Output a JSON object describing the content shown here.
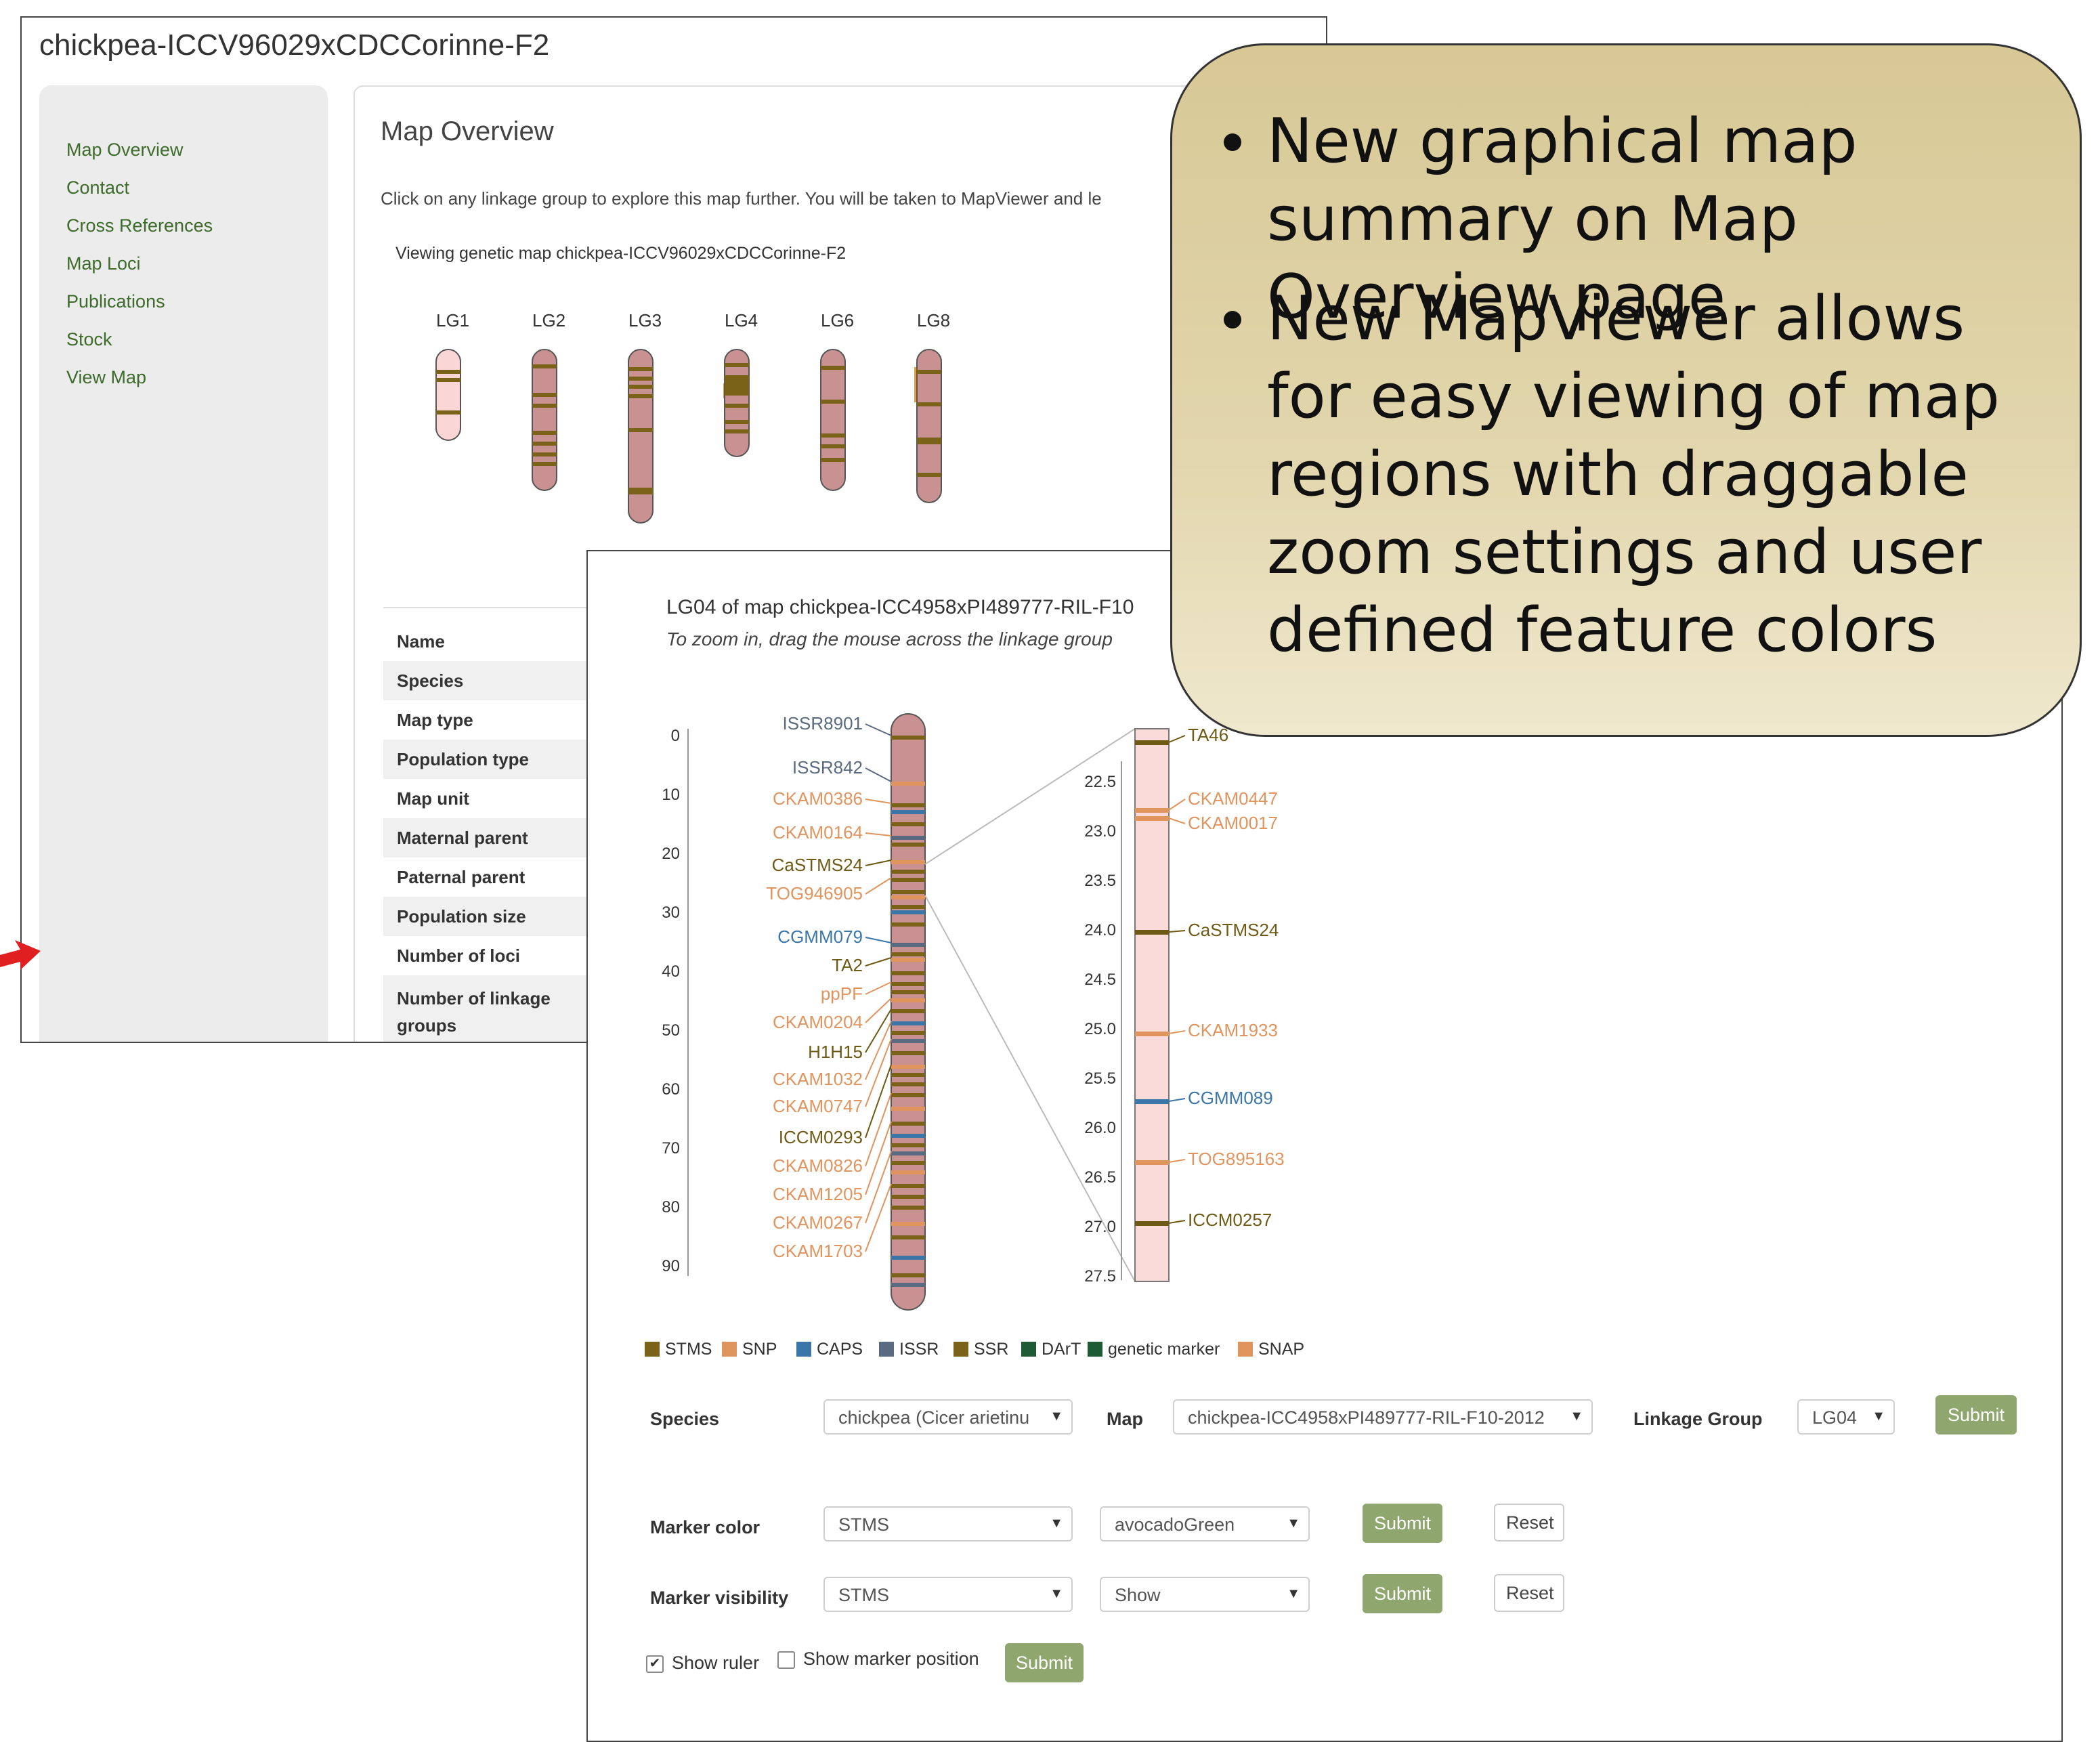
{
  "back_window": {
    "title": "chickpea-ICCV96029xCDCCorinne-F2",
    "sidebar_items": [
      {
        "label": "Map Overview"
      },
      {
        "label": "Contact"
      },
      {
        "label": "Cross References"
      },
      {
        "label": "Map Loci"
      },
      {
        "label": "Publications"
      },
      {
        "label": "Stock"
      },
      {
        "label": "View Map"
      }
    ],
    "heading": "Map Overview",
    "description": "Click on any linkage group to explore this map further. You will be taken to MapViewer and le",
    "viewing_text": "Viewing genetic map chickpea-ICCV96029xCDCCorinne-F2",
    "linkage_groups": [
      "LG1",
      "LG2",
      "LG3",
      "LG4",
      "LG6",
      "LG8"
    ],
    "fields": [
      "Name",
      "Species",
      "Map type",
      "Population type",
      "Map unit",
      "Maternal parent",
      "Paternal parent",
      "Population size",
      "Number of loci",
      "Number of linkage groups"
    ]
  },
  "front_window": {
    "title": "LG04 of map chickpea-ICC4958xPI489777-RIL-F10",
    "subtitle": "To zoom in, drag the mouse across the linkage group",
    "left_axis_ticks": [
      "0",
      "10",
      "20",
      "30",
      "40",
      "50",
      "60",
      "70",
      "80",
      "90"
    ],
    "left_markers": [
      {
        "name": "ISSR8901",
        "color": "#5a6a80"
      },
      {
        "name": "ISSR842",
        "color": "#5a6a80"
      },
      {
        "name": "CKAM0386",
        "color": "#e0945e"
      },
      {
        "name": "CKAM0164",
        "color": "#e0945e"
      },
      {
        "name": "CaSTMS24",
        "color": "#6e5a14"
      },
      {
        "name": "TOG946905",
        "color": "#e0945e"
      },
      {
        "name": "CGMM079",
        "color": "#3a76a8"
      },
      {
        "name": "TA2",
        "color": "#6e5a14"
      },
      {
        "name": "ppPF",
        "color": "#e0945e"
      },
      {
        "name": "CKAM0204",
        "color": "#e0945e"
      },
      {
        "name": "H1H15",
        "color": "#6e5a14"
      },
      {
        "name": "CKAM1032",
        "color": "#e0945e"
      },
      {
        "name": "CKAM0747",
        "color": "#e0945e"
      },
      {
        "name": "ICCM0293",
        "color": "#6e5a14"
      },
      {
        "name": "CKAM0826",
        "color": "#e0945e"
      },
      {
        "name": "CKAM1205",
        "color": "#e0945e"
      },
      {
        "name": "CKAM0267",
        "color": "#e0945e"
      },
      {
        "name": "CKAM1703",
        "color": "#e0945e"
      }
    ],
    "right_axis_ticks": [
      "22.5",
      "23.0",
      "23.5",
      "24.0",
      "24.5",
      "25.0",
      "25.5",
      "26.0",
      "26.5",
      "27.0",
      "27.5"
    ],
    "right_markers": [
      {
        "name": "TA46",
        "color": "#6e5a14"
      },
      {
        "name": "CKAM0447",
        "color": "#e0945e"
      },
      {
        "name": "CKAM0017",
        "color": "#e0945e"
      },
      {
        "name": "CaSTMS24",
        "color": "#6e5a14"
      },
      {
        "name": "CKAM1933",
        "color": "#e0945e"
      },
      {
        "name": "CGMM089",
        "color": "#3a76a8"
      },
      {
        "name": "TOG895163",
        "color": "#e0945e"
      },
      {
        "name": "ICCM0257",
        "color": "#6e5a14"
      }
    ],
    "legend": [
      {
        "label": "STMS",
        "color": "#7a6218"
      },
      {
        "label": "SNP",
        "color": "#e0945e"
      },
      {
        "label": "CAPS",
        "color": "#3a76a8"
      },
      {
        "label": "ISSR",
        "color": "#5a6a80"
      },
      {
        "label": "SSR",
        "color": "#7a6218"
      },
      {
        "label": "DArT",
        "color": "#1e5a34"
      },
      {
        "label": "genetic marker",
        "color": "#1e5a34"
      },
      {
        "label": "SNAP",
        "color": "#e0945e"
      }
    ],
    "form": {
      "species_label": "Species",
      "species_value": "chickpea (Cicer arietinu",
      "map_label": "Map",
      "map_value": "chickpea-ICC4958xPI489777-RIL-F10-2012",
      "linkage_label": "Linkage Group",
      "linkage_value": "LG04",
      "submit": "Submit",
      "reset": "Reset",
      "marker_color_label": "Marker color",
      "marker_color_type": "STMS",
      "marker_color_value": "avocadoGreen",
      "marker_visibility_label": "Marker visibility",
      "marker_visibility_type": "STMS",
      "marker_visibility_value": "Show",
      "show_ruler": "Show ruler",
      "show_marker_position": "Show marker position"
    }
  },
  "callout": {
    "bullets": [
      "New graphical map summary on Map Overview page",
      "New MapViewer allows for easy viewing of map regions with draggable zoom settings and user defined feature colors"
    ]
  },
  "colors": {
    "chromosome_fill": "#c99191",
    "chromosome_band": "#7a6218",
    "link_green": "#3d6b2a",
    "button_green": "#8fa66e",
    "callout_bg": "#d7c895",
    "arrow_red": "#e02020"
  }
}
